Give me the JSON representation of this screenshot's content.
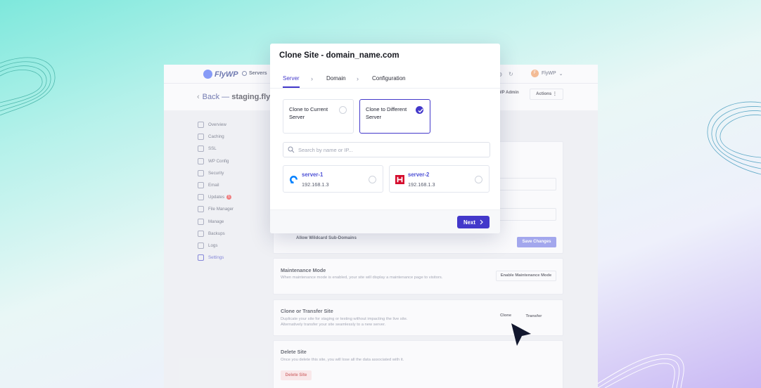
{
  "app": {
    "brand": "FlyWP",
    "nav_servers": "Servers",
    "user_name": "FlyWP",
    "user_initial": "F",
    "back_label": "Back —",
    "site_name": "staging.flywp.",
    "wp_admin": "WP Admin",
    "actions": "Actions"
  },
  "sidebar": {
    "items": [
      {
        "label": "Overview"
      },
      {
        "label": "Caching"
      },
      {
        "label": "SSL"
      },
      {
        "label": "WP Config"
      },
      {
        "label": "Security"
      },
      {
        "label": "Email"
      },
      {
        "label": "Updates",
        "badge": "1"
      },
      {
        "label": "File Manager"
      },
      {
        "label": "Manage"
      },
      {
        "label": "Backups"
      },
      {
        "label": "Logs"
      },
      {
        "label": "Settings"
      }
    ]
  },
  "settings": {
    "wildcard_label": "Allow Wildcard Sub-Domains",
    "save_changes": "Save Changes",
    "maintenance": {
      "title": "Maintenance Mode",
      "desc": "When maintenance mode is enabled, your site will display a maintenance page to visitors.",
      "button": "Enable Maintenance Mode"
    },
    "clone_transfer": {
      "title": "Clone or Transfer Site",
      "desc": "Duplicate your site for staging or testing without impacting the live site. Alternatively transfer your site seamlessly to a new server.",
      "clone_button": "Clone",
      "transfer_button": "Transfer"
    },
    "delete": {
      "title": "Delete Site",
      "desc": "Once you delete this site, you will lose all the data associated with it.",
      "button": "Delete Site"
    }
  },
  "modal": {
    "title": "Clone Site - domain_name.com",
    "steps": [
      "Server",
      "Domain",
      "Configuration"
    ],
    "active_step": "Server",
    "options": [
      {
        "label": "Clone to Current Server",
        "selected": false
      },
      {
        "label": "Clone to Different Server",
        "selected": true
      }
    ],
    "search_placeholder": "Search by name or IP...",
    "servers": [
      {
        "name": "server-1",
        "ip": "192.168.1.3",
        "provider_icon": "digitalocean-icon"
      },
      {
        "name": "server-2",
        "ip": "192.168.1.3",
        "provider_icon": "hetzner-icon"
      }
    ],
    "next_label": "Next"
  },
  "colors": {
    "accent": "#4338ca",
    "link": "#4f52d6",
    "hetzner": "#d50c2d",
    "digitalocean": "#0080ff"
  }
}
